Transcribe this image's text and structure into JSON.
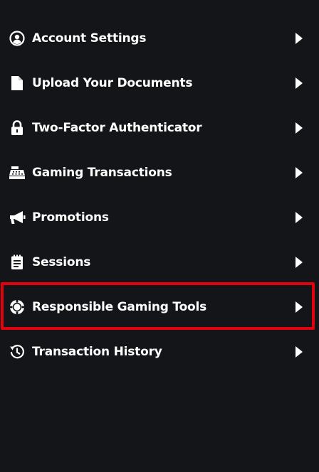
{
  "menu": {
    "items": [
      {
        "label": "Account Settings",
        "icon": "user-circle-icon"
      },
      {
        "label": "Upload Your Documents",
        "icon": "document-icon"
      },
      {
        "label": "Two-Factor Authenticator",
        "icon": "lock-icon"
      },
      {
        "label": "Gaming Transactions",
        "icon": "cash-register-icon"
      },
      {
        "label": "Promotions",
        "icon": "megaphone-icon"
      },
      {
        "label": "Sessions",
        "icon": "notepad-icon"
      },
      {
        "label": "Responsible Gaming Tools",
        "icon": "poker-chip-icon",
        "highlighted": true
      },
      {
        "label": "Transaction History",
        "icon": "history-icon"
      }
    ]
  },
  "colors": {
    "background": "#141518",
    "text": "#ffffff",
    "highlight_border": "#e3000f"
  }
}
